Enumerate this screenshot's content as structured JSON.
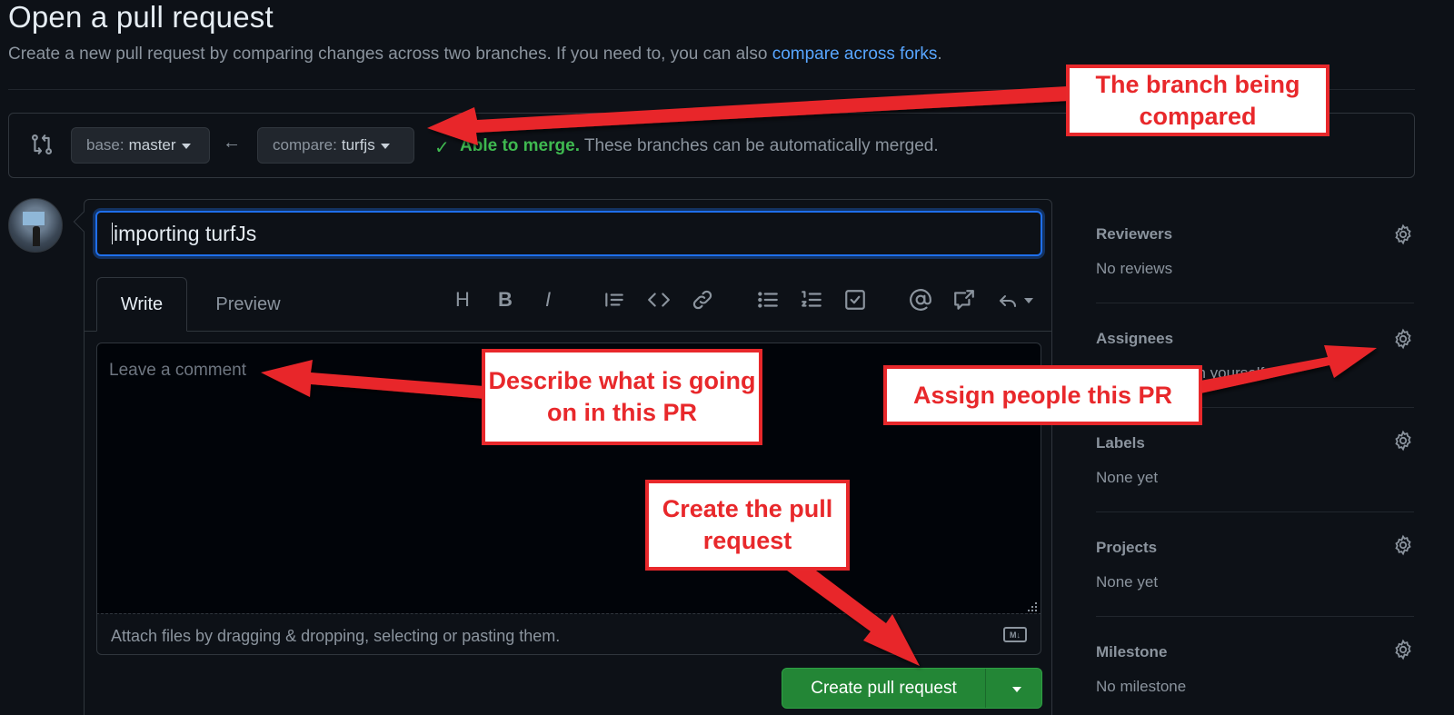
{
  "header": {
    "title": "Open a pull request",
    "subtitle": "Create a new pull request by comparing changes across two branches. If you need to, you can also",
    "compare_forks_link": "compare across forks",
    "subtitle_end": "."
  },
  "range": {
    "base_label": "base:",
    "base_value": "master",
    "compare_label": "compare:",
    "compare_value": "turfjs",
    "merge_status": "Able to merge.",
    "merge_desc": "These branches can be automatically merged."
  },
  "form": {
    "title_value": "importing turfJs",
    "tabs": {
      "write": "Write",
      "preview": "Preview"
    },
    "toolbar": {
      "heading": "H",
      "bold": "B",
      "italic": "I"
    },
    "comment_placeholder": "Leave a comment",
    "attach_text": "Attach files by dragging & dropping, selecting or pasting them.",
    "markdown_badge": "M↓",
    "create_button": "Create pull request"
  },
  "sidebar": {
    "reviewers": {
      "title": "Reviewers",
      "value": "No reviews"
    },
    "assignees": {
      "title": "Assignees",
      "value": "No one—assign yourself"
    },
    "labels": {
      "title": "Labels",
      "value": "None yet"
    },
    "projects": {
      "title": "Projects",
      "value": "None yet"
    },
    "milestone": {
      "title": "Milestone",
      "value": "No milestone"
    }
  },
  "annotations": {
    "branch": "The branch being compared",
    "describe": "Describe what is going on in this PR",
    "assign": "Assign people this PR",
    "create": "Create the pull request"
  },
  "colors": {
    "background": "#0d1117",
    "accent_blue": "#58a6ff",
    "success_green": "#3fb950",
    "button_green": "#238636",
    "annotation_red": "#e8282b"
  },
  "icons": [
    "git-compare-icon",
    "arrow-left-icon",
    "check-icon",
    "heading-icon",
    "bold-icon",
    "italic-icon",
    "quote-icon",
    "code-icon",
    "link-icon",
    "bulleted-list-icon",
    "numbered-list-icon",
    "task-list-icon",
    "mention-icon",
    "cross-reference-icon",
    "reply-icon",
    "gear-icon",
    "markdown-icon"
  ]
}
